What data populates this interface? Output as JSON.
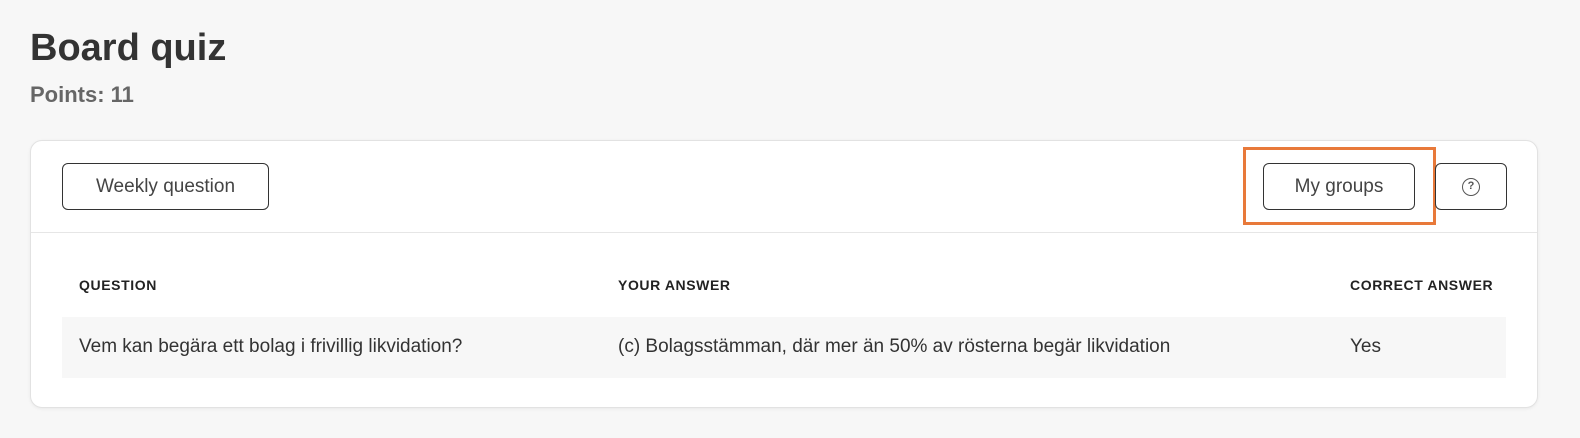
{
  "header": {
    "title": "Board quiz",
    "points_label": "Points:",
    "points_value": "11"
  },
  "toolbar": {
    "weekly_label": "Weekly question",
    "groups_label": "My groups",
    "help_icon": "question-circle-icon",
    "highlight_color": "#e8793a"
  },
  "table": {
    "headers": [
      "QUESTION",
      "YOUR ANSWER",
      "CORRECT ANSWER"
    ],
    "rows": [
      {
        "question": "Vem kan begära ett bolag i frivillig likvidation?",
        "your_answer": "(c) Bolagsstämman, där mer än 50% av rösterna begär likvidation",
        "correct_answer": "Yes"
      }
    ]
  }
}
